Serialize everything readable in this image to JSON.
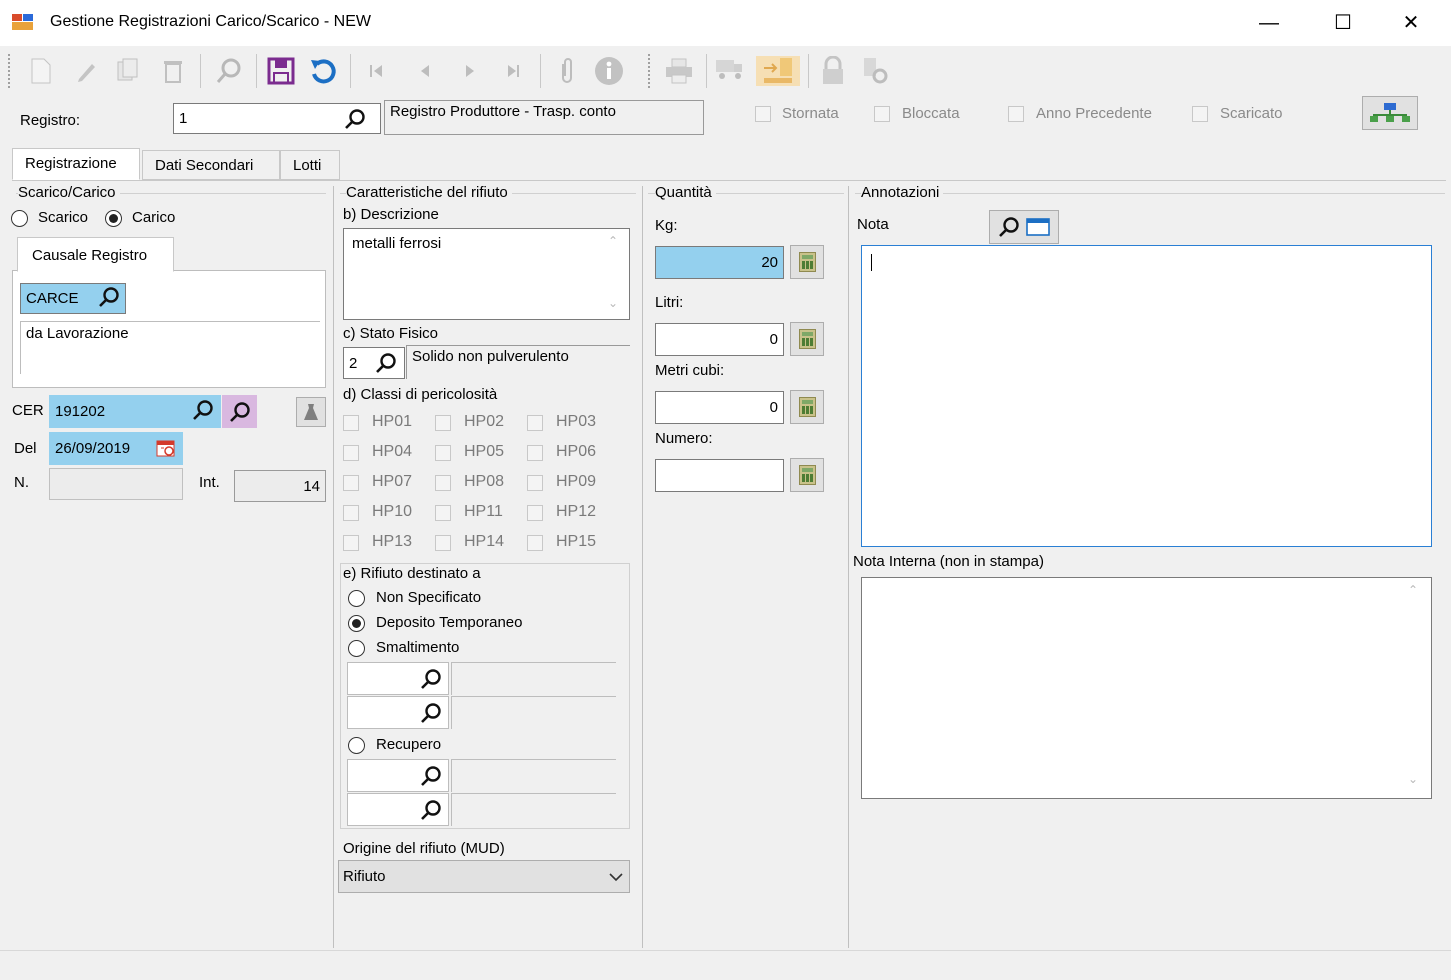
{
  "window": {
    "title": "Gestione Registrazioni Carico/Scarico - NEW",
    "minimize": "—",
    "maximize": "☐",
    "close": "✕"
  },
  "header": {
    "registro_label": "Registro:",
    "registro_value": "1",
    "registro_desc": "Registro Produttore - Trasp. conto",
    "checks": [
      "Stornata",
      "Bloccata",
      "Anno Precedente",
      "Scaricato"
    ]
  },
  "tabs": [
    "Registrazione",
    "Dati Secondari",
    "Lotti"
  ],
  "scarico_carico": {
    "title": "Scarico/Carico",
    "opt_scarico": "Scarico",
    "opt_carico": "Carico",
    "causale_tab": "Causale Registro",
    "causale_code": "CARCE",
    "causale_desc": "da Lavorazione",
    "cer_label": "CER",
    "cer_value": "191202",
    "del_label": "Del",
    "del_value": "26/09/2019",
    "n_label": "N.",
    "n_value": "",
    "int_label": "Int.",
    "int_value": "14"
  },
  "caratteristiche": {
    "title": "Caratteristiche del rifiuto",
    "descrizione_label": "b) Descrizione",
    "descrizione_value": "metalli ferrosi",
    "stato_label": "c) Stato Fisico",
    "stato_code": "2",
    "stato_desc": "Solido non pulverulento",
    "classi_label": "d) Classi di pericolosità",
    "hp": [
      "HP01",
      "HP02",
      "HP03",
      "HP04",
      "HP05",
      "HP06",
      "HP07",
      "HP08",
      "HP09",
      "HP10",
      "HP11",
      "HP12",
      "HP13",
      "HP14",
      "HP15"
    ],
    "destinato_label": "e) Rifiuto destinato a",
    "dest_non_spec": "Non Specificato",
    "dest_deposito": "Deposito Temporaneo",
    "dest_smaltimento": "Smaltimento",
    "dest_recupero": "Recupero",
    "origine_label": "Origine del rifiuto (MUD)",
    "origine_value": "Rifiuto"
  },
  "quantita": {
    "title": "Quantità",
    "kg_label": "Kg:",
    "kg_value": "20",
    "litri_label": "Litri:",
    "litri_value": "0",
    "metri_label": "Metri cubi:",
    "metri_value": "0",
    "numero_label": "Numero:",
    "numero_value": ""
  },
  "annotazioni": {
    "title": "Annotazioni",
    "nota_label": "Nota",
    "nota_value": "",
    "nota_interna_label": "Nota Interna (non in stampa)",
    "nota_interna_value": ""
  },
  "colors": {
    "accent_blue": "#94d0ee",
    "save_purple": "#7b2c8f",
    "undo_blue": "#1c6fc4",
    "focus_border": "#2a7fd4"
  }
}
